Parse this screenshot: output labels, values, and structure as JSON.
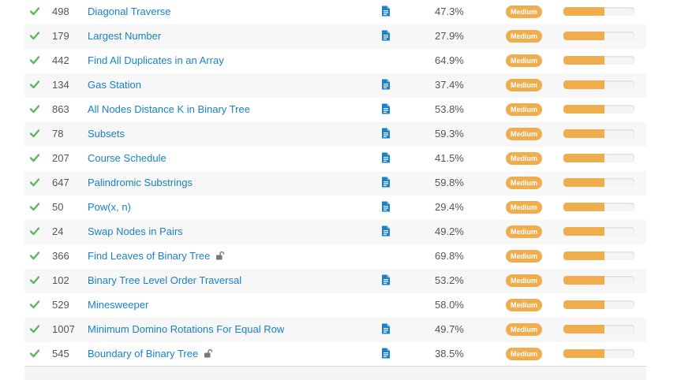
{
  "colors": {
    "accent": "#1a81c3",
    "check": "#5cb85c",
    "medium": "#f0ad4e"
  },
  "problems": [
    {
      "id": "498",
      "title": "Diagonal Traverse",
      "solution": true,
      "locked": false,
      "acceptance": "47.3%",
      "difficulty": "Medium",
      "frequency": 0.58
    },
    {
      "id": "179",
      "title": "Largest Number",
      "solution": true,
      "locked": false,
      "acceptance": "27.9%",
      "difficulty": "Medium",
      "frequency": 0.58
    },
    {
      "id": "442",
      "title": "Find All Duplicates in an Array",
      "solution": false,
      "locked": false,
      "acceptance": "64.9%",
      "difficulty": "Medium",
      "frequency": 0.58
    },
    {
      "id": "134",
      "title": "Gas Station",
      "solution": true,
      "locked": false,
      "acceptance": "37.4%",
      "difficulty": "Medium",
      "frequency": 0.58
    },
    {
      "id": "863",
      "title": "All Nodes Distance K in Binary Tree",
      "solution": true,
      "locked": false,
      "acceptance": "53.8%",
      "difficulty": "Medium",
      "frequency": 0.58
    },
    {
      "id": "78",
      "title": "Subsets",
      "solution": true,
      "locked": false,
      "acceptance": "59.3%",
      "difficulty": "Medium",
      "frequency": 0.58
    },
    {
      "id": "207",
      "title": "Course Schedule",
      "solution": true,
      "locked": false,
      "acceptance": "41.5%",
      "difficulty": "Medium",
      "frequency": 0.58
    },
    {
      "id": "647",
      "title": "Palindromic Substrings",
      "solution": true,
      "locked": false,
      "acceptance": "59.8%",
      "difficulty": "Medium",
      "frequency": 0.58
    },
    {
      "id": "50",
      "title": "Pow(x, n)",
      "solution": true,
      "locked": false,
      "acceptance": "29.4%",
      "difficulty": "Medium",
      "frequency": 0.58
    },
    {
      "id": "24",
      "title": "Swap Nodes in Pairs",
      "solution": true,
      "locked": false,
      "acceptance": "49.2%",
      "difficulty": "Medium",
      "frequency": 0.58
    },
    {
      "id": "366",
      "title": "Find Leaves of Binary Tree",
      "solution": false,
      "locked": true,
      "acceptance": "69.8%",
      "difficulty": "Medium",
      "frequency": 0.58
    },
    {
      "id": "102",
      "title": "Binary Tree Level Order Traversal",
      "solution": true,
      "locked": false,
      "acceptance": "53.2%",
      "difficulty": "Medium",
      "frequency": 0.58
    },
    {
      "id": "529",
      "title": "Minesweeper",
      "solution": false,
      "locked": false,
      "acceptance": "58.0%",
      "difficulty": "Medium",
      "frequency": 0.58
    },
    {
      "id": "1007",
      "title": "Minimum Domino Rotations For Equal Row",
      "solution": true,
      "locked": false,
      "acceptance": "49.7%",
      "difficulty": "Medium",
      "frequency": 0.58
    },
    {
      "id": "545",
      "title": "Boundary of Binary Tree",
      "solution": true,
      "locked": true,
      "acceptance": "38.5%",
      "difficulty": "Medium",
      "frequency": 0.58
    }
  ]
}
